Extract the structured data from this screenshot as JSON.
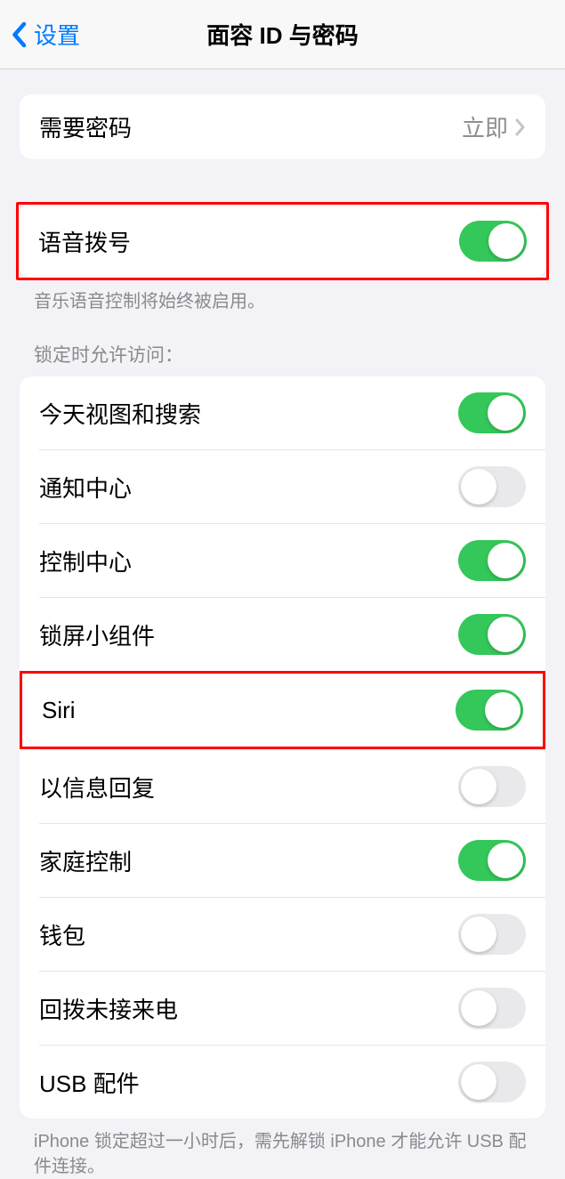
{
  "header": {
    "back_label": "设置",
    "title": "面容 ID 与密码"
  },
  "passcode_group": {
    "require_label": "需要密码",
    "require_value": "立即"
  },
  "voice_dial": {
    "label": "语音拨号",
    "enabled": true,
    "footer": "音乐语音控制将始终被启用。"
  },
  "lock_access": {
    "header": "锁定时允许访问：",
    "items": [
      {
        "label": "今天视图和搜索",
        "enabled": true
      },
      {
        "label": "通知中心",
        "enabled": false
      },
      {
        "label": "控制中心",
        "enabled": true
      },
      {
        "label": "锁屏小组件",
        "enabled": true
      },
      {
        "label": "Siri",
        "enabled": true
      },
      {
        "label": "以信息回复",
        "enabled": false
      },
      {
        "label": "家庭控制",
        "enabled": true
      },
      {
        "label": "钱包",
        "enabled": false
      },
      {
        "label": "回拨未接来电",
        "enabled": false
      },
      {
        "label": "USB 配件",
        "enabled": false
      }
    ],
    "footer": "iPhone 锁定超过一小时后，需先解锁 iPhone 才能允许 USB 配件连接。"
  }
}
